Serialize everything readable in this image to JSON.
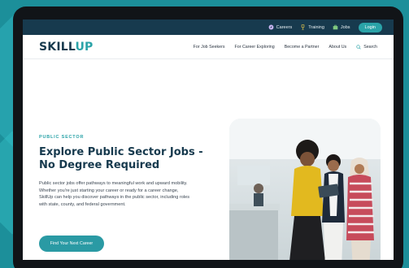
{
  "topbar": {
    "items": [
      {
        "label": "Careers",
        "icon": "compass-icon"
      },
      {
        "label": "Training",
        "icon": "trophy-icon"
      },
      {
        "label": "Jobs",
        "icon": "briefcase-icon"
      }
    ],
    "login_label": "Login"
  },
  "nav": {
    "logo_prefix": "SKILL",
    "logo_accent": "UP",
    "links": [
      "For Job Seekers",
      "For Career Exploring",
      "Become a Partner",
      "About Us"
    ],
    "search_label": "Search"
  },
  "hero": {
    "eyebrow": "PUBLIC SECTOR",
    "headline": "Explore Public Sector Jobs - No Degree Required",
    "body": "Public sector jobs offer pathways to meaningful work and upward mobility. Whether you're just starting your career or ready for a career change, SkillUp can help you discover pathways in the public sector, including roles with state, county, and federal government.",
    "cta_label": "Find Your Next Career"
  },
  "colors": {
    "brand_navy": "#173a4e",
    "brand_teal": "#2aa3a8",
    "background": "#1c8f9a"
  }
}
